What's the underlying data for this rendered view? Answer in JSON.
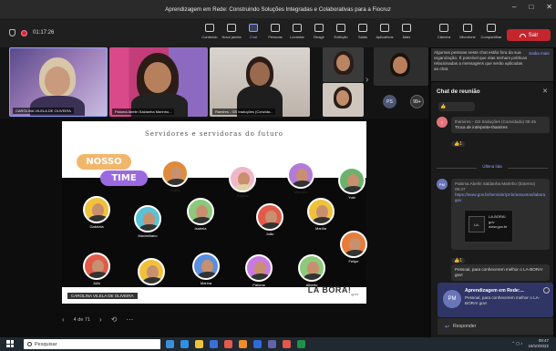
{
  "window": {
    "title": "Aprendizagem em Rede: Construindo Soluções Integradas e Colaborativas para a Fiocruz",
    "minimize": "–",
    "maximize": "□",
    "close": "✕"
  },
  "toolbar": {
    "timer": "01:17:26",
    "items": [
      {
        "label": "Conteúdo"
      },
      {
        "label": "Nova janela"
      },
      {
        "label": "Chat"
      },
      {
        "label": "Pessoas"
      },
      {
        "label": "Levantar"
      },
      {
        "label": "Reagir"
      },
      {
        "label": "Exibição"
      },
      {
        "label": "Salas"
      },
      {
        "label": "Aplicativos"
      },
      {
        "label": "Mais"
      }
    ],
    "right_items": [
      {
        "label": "Câmera"
      },
      {
        "label": "Microfone"
      },
      {
        "label": "Compartilhar"
      }
    ],
    "leave_label": "Sair"
  },
  "participants": {
    "tile1_name": "CAROLINA VILELA DE OLIVEIRA",
    "tile2_name": "Paloma Abelin Saldanha Marinho...",
    "tile3_name": "Ramires - GS traduções (Convida...",
    "ps_initials": "PS",
    "more_count": "99+"
  },
  "notice": {
    "text": "Algumas pessoas neste chat estão fora da sua organização. É possível que elas tenham políticas relacionadas a mensagens que serão aplicadas ao chat.",
    "link": "Saiba mais"
  },
  "slide": {
    "title": "Servidores e servidoras do futuro",
    "badge1": "NOSSO",
    "badge2": "TIME",
    "members": [
      {
        "name": "Luana"
      },
      {
        "name": "Raquel"
      },
      {
        "name": "Marcelo"
      },
      {
        "name": "Yuki"
      },
      {
        "name": "Gabriela"
      },
      {
        "name": "Maximiliano"
      },
      {
        "name": "Isabela"
      },
      {
        "name": "João"
      },
      {
        "name": "Marília"
      },
      {
        "name": "Felipe"
      },
      {
        "name": "Júlio"
      },
      {
        "name": "Carol"
      },
      {
        "name": "Marina"
      },
      {
        "name": "Paloma"
      },
      {
        "name": "Alberto"
      }
    ],
    "presenter_caption": "CAROLINA VILELA DE OLIVEIRA",
    "logo": "LA BORA!",
    "logo_sub": "gov",
    "page_indicator": "4 de 71"
  },
  "chat": {
    "title": "Chat de reunião",
    "messages": [
      {
        "initials": "T",
        "author": "thamires - GS traduções (Convidado)",
        "time": "09:45",
        "text": "Troca de intérprete-thamires",
        "reaction": "👍1"
      },
      {
        "initials": "PM",
        "author": "Paloma Abelin Saldanha Marinho (Externo)",
        "time": "09:47",
        "link": "https://www.gov.br/servidor/pt-br/assuntos/laboragov",
        "preview_title": "LA-BORA! gov",
        "preview_site": "www.gov.br",
        "reaction": "👍1"
      },
      {
        "text": "Pessoal, para conhecerem melhor o LA-BORA! gov!"
      }
    ],
    "divider": "Última lida"
  },
  "toast": {
    "initials": "PM",
    "title": "Aprendizagem em Rede:...",
    "text": "Pessoal, para conhecerem melhor o LA-BORA! gov!",
    "reply": "Responder"
  },
  "taskbar": {
    "search_placeholder": "Pesquisar",
    "time": "09:47",
    "date": "18/10/2022"
  }
}
